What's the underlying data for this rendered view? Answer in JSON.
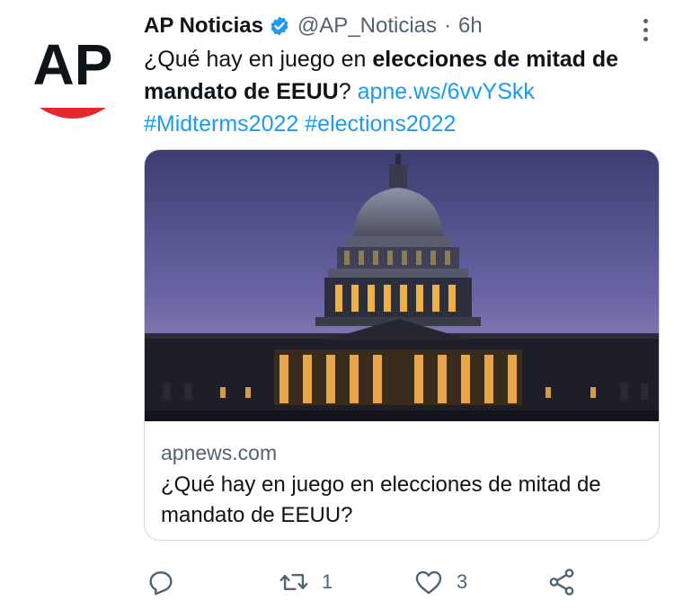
{
  "tweet": {
    "author_name": "AP Noticias",
    "handle": "@AP_Noticias",
    "separator": "·",
    "time": "6h",
    "text_intro": "¿Qué hay en juego en ",
    "text_bold": "elecciones de mitad de mandato de EEUU",
    "text_after": "? ",
    "link": "apne.ws/6vvYSkk",
    "hashtags": [
      "#Midterms2022",
      "#elections2022"
    ],
    "avatar_text": "AP",
    "avatar_icon": "ap-logo-icon",
    "verified_icon": "verified-badge-icon",
    "more_icon": "more-options-icon"
  },
  "card": {
    "image_icon": "us-capitol-image",
    "domain": "apnews.com",
    "title": "¿Qué hay en juego en elecciones de mitad de mandato de EEUU?"
  },
  "actions": {
    "reply": {
      "icon": "reply-icon",
      "count": ""
    },
    "retweet": {
      "icon": "retweet-icon",
      "count": "1"
    },
    "like": {
      "icon": "like-icon",
      "count": "3"
    },
    "share": {
      "icon": "share-icon",
      "count": ""
    }
  },
  "colors": {
    "link": "#1d9bf0",
    "secondary_text": "#536471",
    "primary_text": "#0f1419",
    "ap_red": "#e8262d",
    "card_border": "#cfd9de"
  }
}
